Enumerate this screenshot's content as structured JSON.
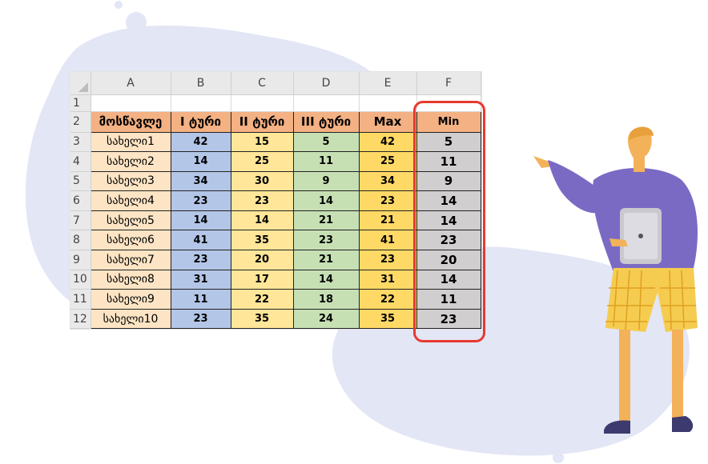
{
  "spreadsheet": {
    "column_headers": [
      "A",
      "B",
      "C",
      "D",
      "E",
      "F"
    ],
    "row_numbers": [
      "1",
      "2",
      "3",
      "4",
      "5",
      "6",
      "7",
      "8",
      "9",
      "10",
      "11",
      "12"
    ],
    "header_row": [
      "მოსწავლე",
      "I ტური",
      "II ტური",
      "III ტური",
      "Max",
      "Min"
    ],
    "rows": [
      [
        "სახელი1",
        "42",
        "15",
        "5",
        "42",
        "5"
      ],
      [
        "სახელი2",
        "14",
        "25",
        "11",
        "25",
        "11"
      ],
      [
        "სახელი3",
        "34",
        "30",
        "9",
        "34",
        "9"
      ],
      [
        "სახელი4",
        "23",
        "23",
        "14",
        "23",
        "14"
      ],
      [
        "სახელი5",
        "14",
        "14",
        "21",
        "21",
        "14"
      ],
      [
        "სახელი6",
        "41",
        "35",
        "23",
        "41",
        "23"
      ],
      [
        "სახელი7",
        "23",
        "20",
        "21",
        "23",
        "20"
      ],
      [
        "სახელი8",
        "31",
        "17",
        "14",
        "31",
        "14"
      ],
      [
        "სახელი9",
        "11",
        "22",
        "18",
        "22",
        "11"
      ],
      [
        "სახელი10",
        "23",
        "35",
        "24",
        "35",
        "23"
      ]
    ]
  },
  "colors": {
    "highlight_border": "#e8392f",
    "header_orange": "#f4b183",
    "name_fill": "#fce4c4",
    "round1_fill": "#b4c6e7",
    "round2_fill": "#ffe699",
    "round3_fill": "#c6e0b4",
    "max_fill": "#ffd966",
    "min_fill": "#d0cece",
    "blob": "#e3e6f5",
    "person_sweater": "#7b6ac4",
    "person_pants": "#f5cc50"
  },
  "icons": [
    "select-all-corner-icon",
    "person-illustration",
    "tablet-icon"
  ]
}
